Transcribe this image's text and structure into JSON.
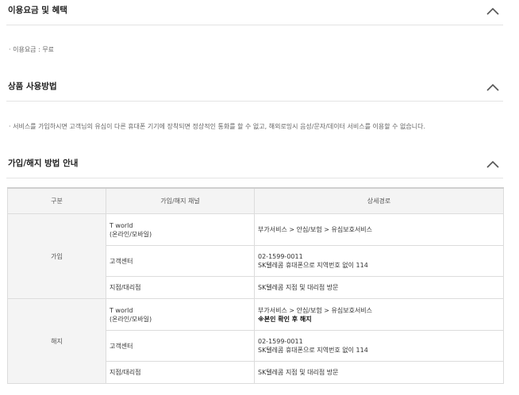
{
  "sections": {
    "fee": {
      "title": "이용요금 및 혜택",
      "bullet": "이용요금 : 무료"
    },
    "usage": {
      "title": "상품 사용방법",
      "bullet": "서비스를 가입하시면 고객님의 유심이 다른 휴대폰 기기에 장착되면 정상적인 통화를 할 수 없고, 해외로밍시 음성/문자/데이터 서비스를 이용할 수 없습니다."
    },
    "join": {
      "title": "가입/해지 방법 안내"
    }
  },
  "icons": {
    "section_toggle": "chevron-up-icon",
    "bullet": "middle-dot"
  },
  "table": {
    "headers": [
      "구분",
      "가입/해지 채널",
      "상세경로"
    ],
    "groups": [
      {
        "label": "가입",
        "rows": [
          {
            "channel_line1": "T world",
            "channel_line2": "(온라인/모바일)",
            "detail_line1": "부가서비스 > 안심/보험 > 유심보호서비스",
            "detail_line2": ""
          },
          {
            "channel_line1": "고객센터",
            "channel_line2": "",
            "detail_line1": "02-1599-0011",
            "detail_line2": "SK텔레콤 휴대폰으로 지역번호 없이 114"
          },
          {
            "channel_line1": "지점/대리점",
            "channel_line2": "",
            "detail_line1": "SK텔레콤 지점 및 대리점 방문",
            "detail_line2": ""
          }
        ]
      },
      {
        "label": "해지",
        "rows": [
          {
            "channel_line1": "T world",
            "channel_line2": "(온라인/모바일)",
            "detail_line1": "부가서비스 > 안심/보험 > 유심보호서비스",
            "detail_line2": "※본인 확인 후 해지"
          },
          {
            "channel_line1": "고객센터",
            "channel_line2": "",
            "detail_line1": "02-1599-0011",
            "detail_line2": "SK텔레콤 휴대폰으로 지역번호 없이 114"
          },
          {
            "channel_line1": "지점/대리점",
            "channel_line2": "",
            "detail_line1": "SK텔레콤 지점 및 대리점 방문",
            "detail_line2": ""
          }
        ]
      }
    ]
  },
  "colors": {
    "border": "#dcdcdc",
    "header_bg": "#f4f4f4",
    "text": "#333333"
  }
}
